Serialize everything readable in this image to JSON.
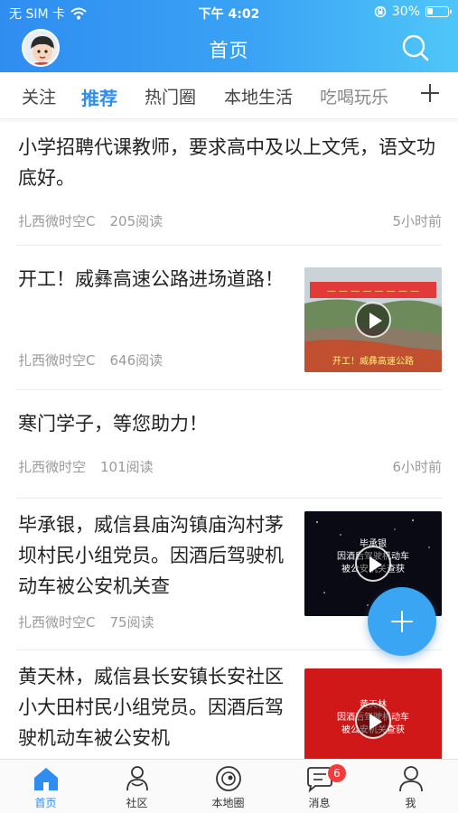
{
  "status_bar": {
    "carrier": "无 SIM 卡",
    "time": "下午 4:02",
    "battery_percent": "30%",
    "battery_level": 0.3,
    "icons": [
      "wifi-icon",
      "orientation-lock-icon",
      "battery-icon"
    ]
  },
  "nav": {
    "title": "首页",
    "icons": [
      "avatar",
      "search-icon"
    ]
  },
  "tabs": [
    "关注",
    "推荐",
    "热门圈",
    "本地生活",
    "吃喝玩乐"
  ],
  "active_tab": "推荐",
  "feed": [
    {
      "title": "小学招聘代课教师，要求高中及以上文凭，语文功底好。",
      "author": "扎西微时空C",
      "reads": "205阅读",
      "time": "5小时前"
    },
    {
      "title": "开工！威彝高速公路进场道路！",
      "author": "扎西微时空C",
      "reads": "646阅读",
      "thumb_caption": "开工！威彝高速公路",
      "has_video": true
    },
    {
      "title": "寒门学子，等您助力！",
      "author": "扎西微时空",
      "reads": "101阅读",
      "time": "6小时前"
    },
    {
      "title": "毕承银，威信县庙沟镇庙沟村茅坝村民小组党员。因酒后驾驶机动车被公安机关查",
      "author": "扎西微时空C",
      "reads": "75阅读",
      "thumb_caption": "毕承银\n因酒后驾驶机动车\n被公安机关查获",
      "has_video": true
    },
    {
      "title": "黄天林，威信县长安镇长安社区小大田村民小组党员。因酒后驾驶机动车被公安机",
      "thumb_caption": "黄天林\n因酒后驾驶机动车\n被公安机关查获",
      "has_video": true
    }
  ],
  "bottom_nav": [
    {
      "label": "首页",
      "icon": "home-icon",
      "active": true
    },
    {
      "label": "社区",
      "icon": "community-icon",
      "active": false
    },
    {
      "label": "本地圈",
      "icon": "local-circle-icon",
      "active": false
    },
    {
      "label": "消息",
      "icon": "message-icon",
      "active": false,
      "badge": "6"
    },
    {
      "label": "我",
      "icon": "profile-icon",
      "active": false
    }
  ],
  "colors": {
    "header_start": "#2f8df0",
    "header_end": "#4fc6f8",
    "accent": "#2f8df0",
    "badge": "#f23c3c",
    "fab": "#3aa6f3"
  }
}
